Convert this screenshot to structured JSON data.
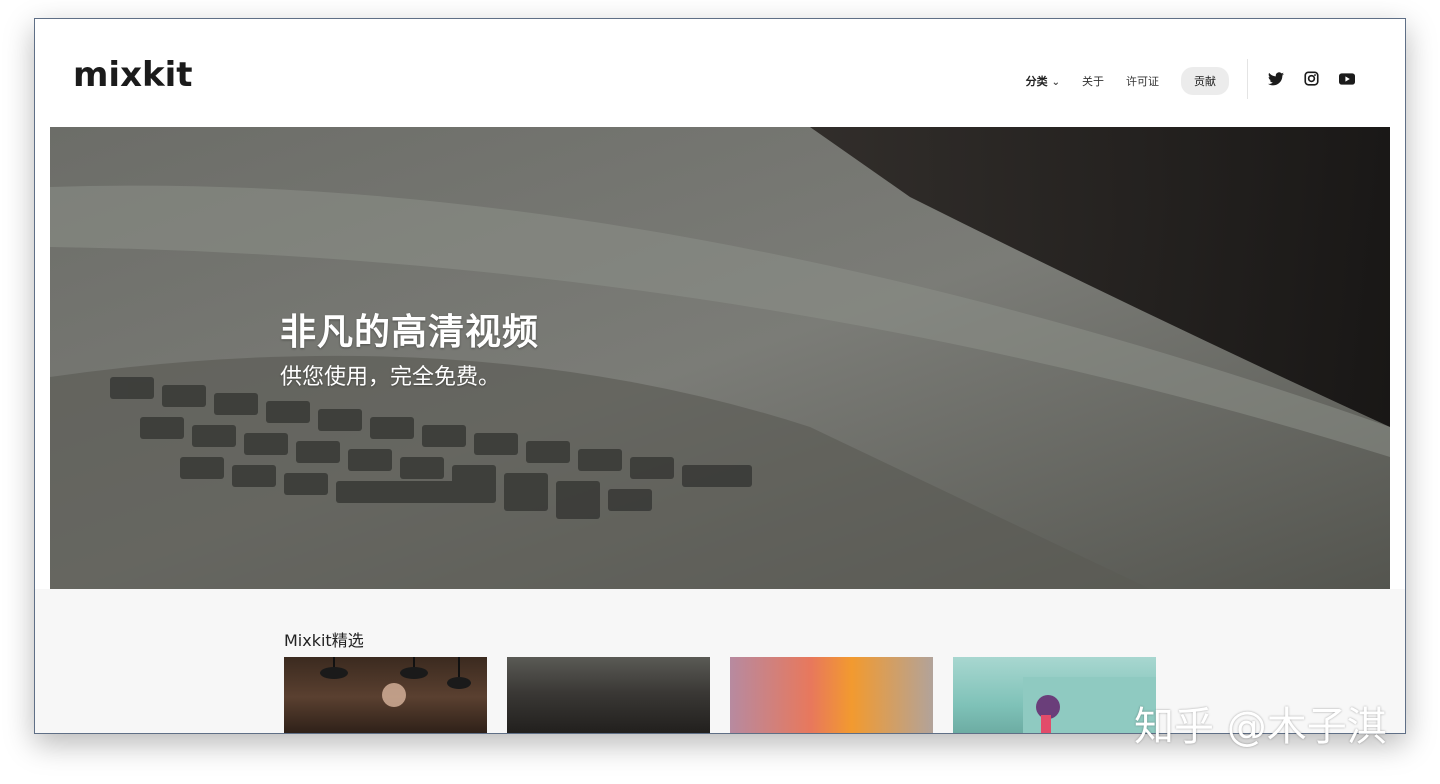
{
  "brand": {
    "logo_text": "mixkit"
  },
  "nav": {
    "categories": "分类",
    "about": "关于",
    "license": "许可证",
    "contribute": "贡献"
  },
  "social": {
    "twitter": "twitter-icon",
    "instagram": "instagram-icon",
    "youtube": "youtube-icon"
  },
  "hero": {
    "title": "非凡的高清视频",
    "subtitle": "供您使用，完全免费。"
  },
  "featured": {
    "title": "Mixkit精选",
    "thumbnails": [
      {
        "label": "featured-thumb-1"
      },
      {
        "label": "featured-thumb-2"
      },
      {
        "label": "featured-thumb-3"
      },
      {
        "label": "featured-thumb-4"
      }
    ]
  },
  "watermark": "知乎 @木子淇",
  "colors": {
    "accent_pill": "#ececec",
    "text": "#222222"
  }
}
